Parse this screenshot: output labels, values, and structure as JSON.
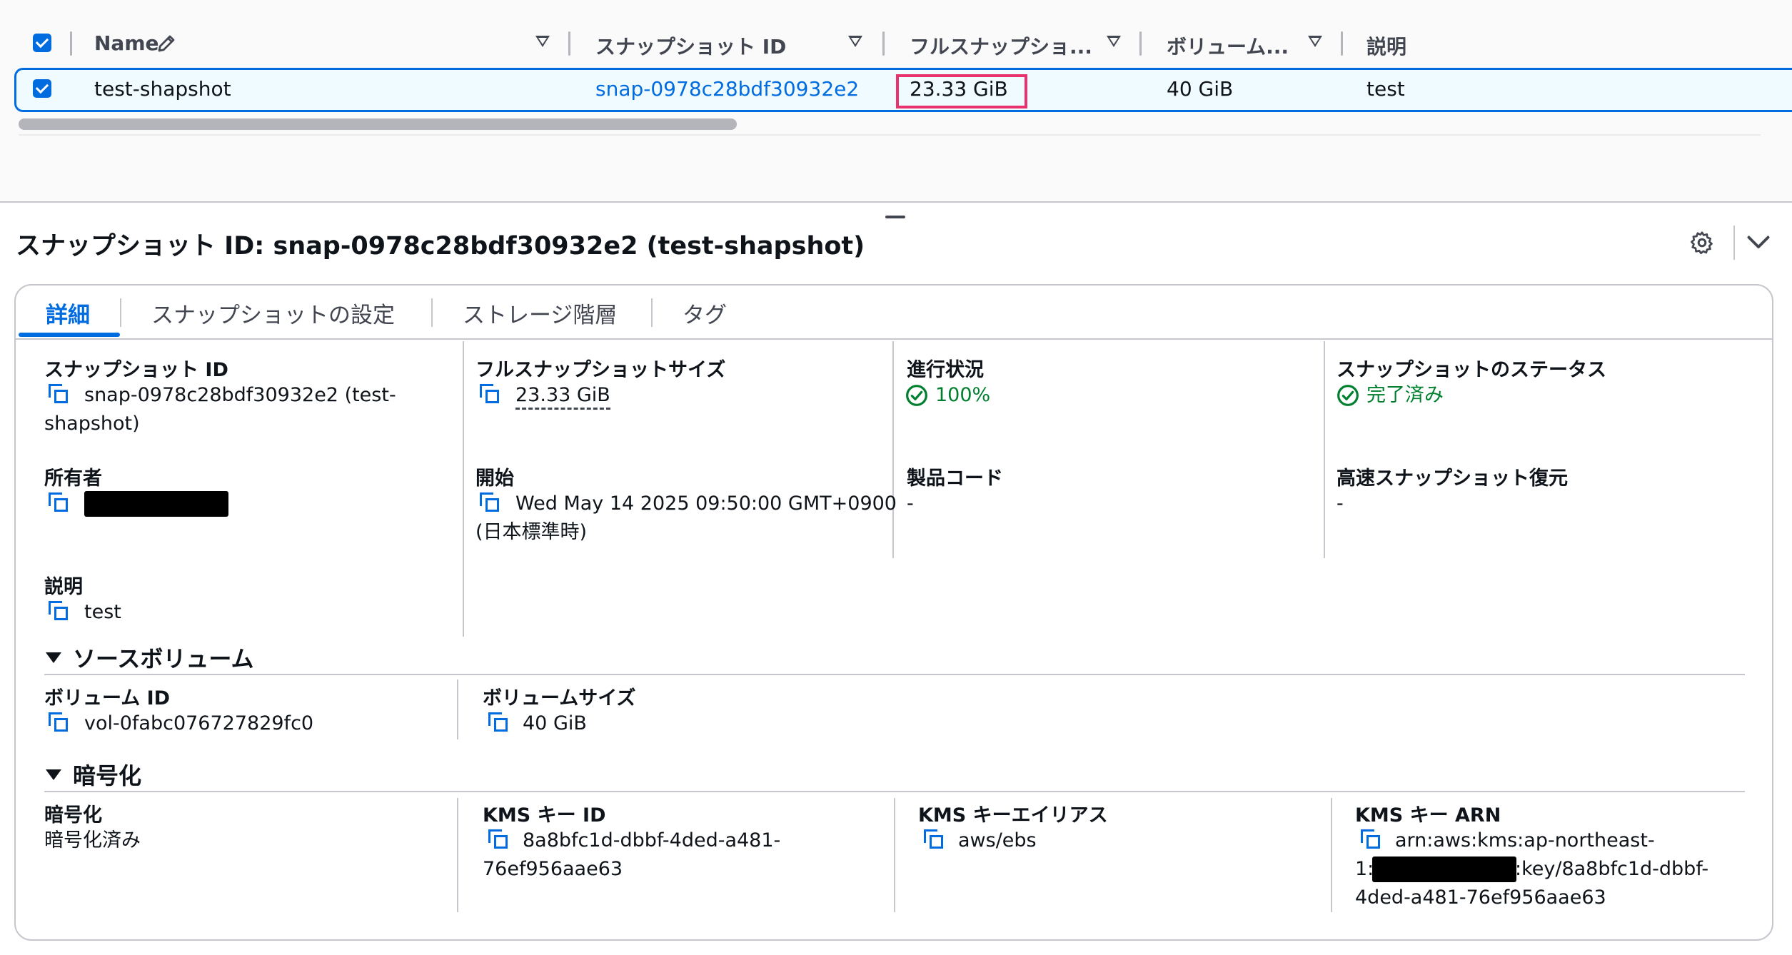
{
  "table": {
    "headers": [
      {
        "label": "Name"
      },
      {
        "label": "スナップショット ID"
      },
      {
        "label": "フルスナップショ..."
      },
      {
        "label": "ボリューム..."
      },
      {
        "label": "説明"
      }
    ],
    "row": {
      "name": "test-shapshot",
      "snapshot_id": "snap-0978c28bdf30932e2",
      "full_size": "23.33 GiB",
      "volume_size": "40 GiB",
      "description": "test"
    }
  },
  "detail": {
    "title": "スナップショット ID: snap-0978c28bdf30932e2 (test-shapshot)",
    "tabs": [
      "詳細",
      "スナップショットの設定",
      "ストレージ階層",
      "タグ"
    ],
    "fields": {
      "snapshot_id_label": "スナップショット ID",
      "snapshot_id_value_1": "snap-0978c28bdf30932e2 (test-",
      "snapshot_id_value_2": "shapshot)",
      "full_size_label": "フルスナップショットサイズ",
      "full_size_value": "23.33 GiB",
      "progress_label": "進行状況",
      "progress_value": "100%",
      "status_label": "スナップショットのステータス",
      "status_value": "完了済み",
      "owner_label": "所有者",
      "start_label": "開始",
      "start_value_1": "Wed May 14 2025 09:50:00 GMT+0900",
      "start_value_2": "(日本標準時)",
      "product_code_label": "製品コード",
      "product_code_value": "-",
      "fast_restore_label": "高速スナップショット復元",
      "fast_restore_value": "-",
      "description_label": "説明",
      "description_value": "test"
    },
    "source_volume": {
      "section_title": "ソースボリューム",
      "volume_id_label": "ボリューム ID",
      "volume_id_value": "vol-0fabc076727829fc0",
      "volume_size_label": "ボリュームサイズ",
      "volume_size_value": "40 GiB"
    },
    "encryption": {
      "section_title": "暗号化",
      "encryption_label": "暗号化",
      "encryption_value": "暗号化済み",
      "kms_id_label": "KMS キー ID",
      "kms_id_value_1": "8a8bfc1d-dbbf-4ded-a481-",
      "kms_id_value_2": "76ef956aae63",
      "kms_alias_label": "KMS キーエイリアス",
      "kms_alias_value": "aws/ebs",
      "kms_arn_label": "KMS キー ARN",
      "kms_arn_value_1": "arn:aws:kms:ap-northeast-",
      "kms_arn_value_2a": "1:",
      "kms_arn_value_2b": ":key/8a8bfc1d-dbbf-",
      "kms_arn_value_3": "4ded-a481-76ef956aae63"
    }
  },
  "colors": {
    "accent": "#006ce0",
    "success": "#00802f",
    "highlight": "#e8336f"
  },
  "icons": [
    "edit-pencil-icon",
    "sort-caret-icon",
    "copy-icon",
    "success-check-icon",
    "gear-icon",
    "chevron-down-icon",
    "expand-triangle-icon"
  ]
}
